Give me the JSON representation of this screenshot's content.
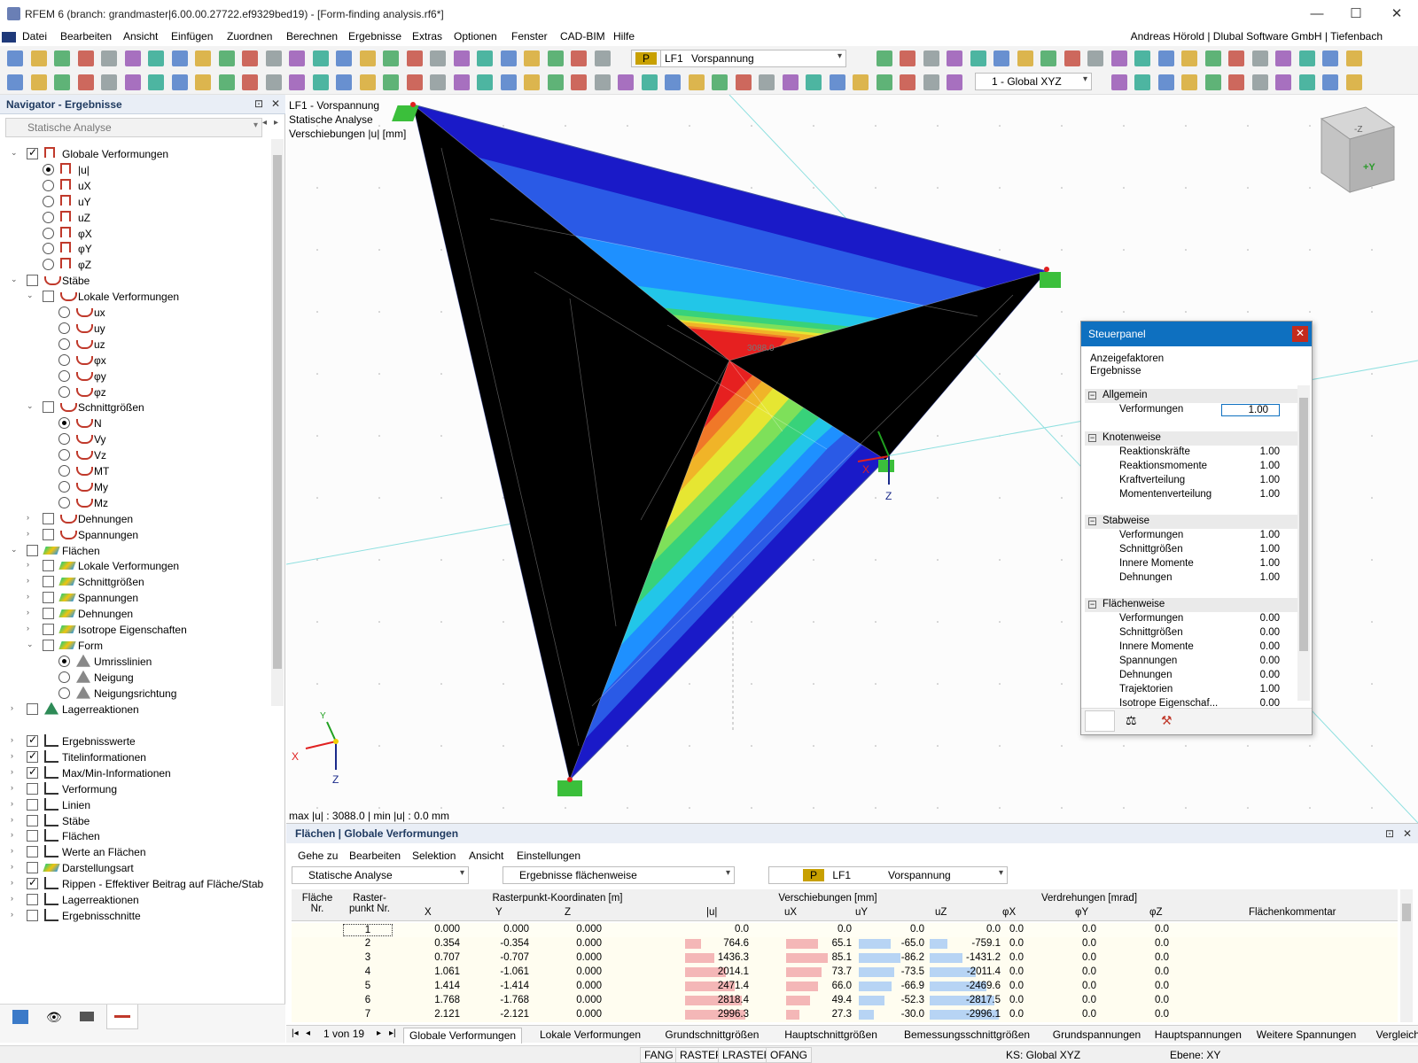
{
  "window": {
    "title": "RFEM 6 (branch: grandmaster|6.00.00.27722.ef9329bed19) - [Form-finding analysis.rf6*]"
  },
  "menu": {
    "items": [
      "Datei",
      "Bearbeiten",
      "Ansicht",
      "Einfügen",
      "Zuordnen",
      "Berechnen",
      "Ergebnisse",
      "Extras",
      "Optionen",
      "Fenster",
      "CAD-BIM",
      "Hilfe"
    ],
    "user": "Andreas Hörold | Dlubal Software GmbH | Tiefenbach"
  },
  "toolbar": {
    "lc_code": "P",
    "lc_name": "LF1",
    "lc_desc": "Vorspannung",
    "coord_system": "1 - Global XYZ"
  },
  "navigator": {
    "title": "Navigator - Ergebnisse",
    "analysis": "Statische Analyse",
    "items": [
      {
        "label": "Globale Verformungen",
        "level": 0,
        "ctrl": "cb",
        "checked": true,
        "exp": "v",
        "icon": "def"
      },
      {
        "label": "|u|",
        "level": 1,
        "ctrl": "rb",
        "checked": true,
        "icon": "def"
      },
      {
        "label": "uX",
        "level": 1,
        "ctrl": "rb",
        "checked": false,
        "icon": "def"
      },
      {
        "label": "uY",
        "level": 1,
        "ctrl": "rb",
        "checked": false,
        "icon": "def"
      },
      {
        "label": "uZ",
        "level": 1,
        "ctrl": "rb",
        "checked": false,
        "icon": "def"
      },
      {
        "label": "φX",
        "level": 1,
        "ctrl": "rb",
        "checked": false,
        "icon": "def"
      },
      {
        "label": "φY",
        "level": 1,
        "ctrl": "rb",
        "checked": false,
        "icon": "def"
      },
      {
        "label": "φZ",
        "level": 1,
        "ctrl": "rb",
        "checked": false,
        "icon": "def"
      },
      {
        "label": "Stäbe",
        "level": 0,
        "ctrl": "cb",
        "checked": false,
        "exp": "v",
        "icon": "memb"
      },
      {
        "label": "Lokale Verformungen",
        "level": 1,
        "ctrl": "cb",
        "checked": false,
        "exp": "v",
        "icon": "memb"
      },
      {
        "label": "ux",
        "level": 2,
        "ctrl": "rb",
        "checked": false,
        "icon": "memb"
      },
      {
        "label": "uy",
        "level": 2,
        "ctrl": "rb",
        "checked": false,
        "icon": "memb"
      },
      {
        "label": "uz",
        "level": 2,
        "ctrl": "rb",
        "checked": false,
        "icon": "memb"
      },
      {
        "label": "φx",
        "level": 2,
        "ctrl": "rb",
        "checked": false,
        "icon": "memb"
      },
      {
        "label": "φy",
        "level": 2,
        "ctrl": "rb",
        "checked": false,
        "icon": "memb"
      },
      {
        "label": "φz",
        "level": 2,
        "ctrl": "rb",
        "checked": false,
        "icon": "memb"
      },
      {
        "label": "Schnittgrößen",
        "level": 1,
        "ctrl": "cb",
        "checked": false,
        "exp": "v",
        "icon": "memb"
      },
      {
        "label": "N",
        "level": 2,
        "ctrl": "rb",
        "checked": true,
        "icon": "memb"
      },
      {
        "label": "Vy",
        "level": 2,
        "ctrl": "rb",
        "checked": false,
        "icon": "memb"
      },
      {
        "label": "Vz",
        "level": 2,
        "ctrl": "rb",
        "checked": false,
        "icon": "memb"
      },
      {
        "label": "MT",
        "level": 2,
        "ctrl": "rb",
        "checked": false,
        "icon": "memb"
      },
      {
        "label": "My",
        "level": 2,
        "ctrl": "rb",
        "checked": false,
        "icon": "memb"
      },
      {
        "label": "Mz",
        "level": 2,
        "ctrl": "rb",
        "checked": false,
        "icon": "memb"
      },
      {
        "label": "Dehnungen",
        "level": 1,
        "ctrl": "cb",
        "checked": false,
        "exp": ">",
        "icon": "memb"
      },
      {
        "label": "Spannungen",
        "level": 1,
        "ctrl": "cb",
        "checked": false,
        "exp": ">",
        "icon": "memb"
      },
      {
        "label": "Flächen",
        "level": 0,
        "ctrl": "cb",
        "checked": false,
        "exp": "v",
        "icon": "surf"
      },
      {
        "label": "Lokale Verformungen",
        "level": 1,
        "ctrl": "cb",
        "checked": false,
        "exp": ">",
        "icon": "surf"
      },
      {
        "label": "Schnittgrößen",
        "level": 1,
        "ctrl": "cb",
        "checked": false,
        "exp": ">",
        "icon": "surf"
      },
      {
        "label": "Spannungen",
        "level": 1,
        "ctrl": "cb",
        "checked": false,
        "exp": ">",
        "icon": "surf"
      },
      {
        "label": "Dehnungen",
        "level": 1,
        "ctrl": "cb",
        "checked": false,
        "exp": ">",
        "icon": "surf"
      },
      {
        "label": "Isotrope Eigenschaften",
        "level": 1,
        "ctrl": "cb",
        "checked": false,
        "exp": ">",
        "icon": "surf"
      },
      {
        "label": "Form",
        "level": 1,
        "ctrl": "cb",
        "checked": false,
        "exp": "v",
        "icon": "surf"
      },
      {
        "label": "Umrisslinien",
        "level": 2,
        "ctrl": "rb",
        "checked": true,
        "icon": "shape"
      },
      {
        "label": "Neigung",
        "level": 2,
        "ctrl": "rb",
        "checked": false,
        "icon": "shape"
      },
      {
        "label": "Neigungsrichtung",
        "level": 2,
        "ctrl": "rb",
        "checked": false,
        "icon": "shape"
      },
      {
        "label": "Lagerreaktionen",
        "level": 0,
        "ctrl": "cb",
        "checked": false,
        "exp": ">",
        "icon": "sup"
      }
    ],
    "display_items": [
      {
        "label": "Ergebnisswerte",
        "checked": true,
        "icon": "res"
      },
      {
        "label": "Titelinformationen",
        "checked": true,
        "icon": "res"
      },
      {
        "label": "Max/Min-Informationen",
        "checked": true,
        "icon": "res"
      },
      {
        "label": "Verformung",
        "checked": false,
        "icon": "res"
      },
      {
        "label": "Linien",
        "checked": false,
        "icon": "res"
      },
      {
        "label": "Stäbe",
        "checked": false,
        "icon": "res"
      },
      {
        "label": "Flächen",
        "checked": false,
        "icon": "res"
      },
      {
        "label": "Werte an Flächen",
        "checked": false,
        "icon": "res"
      },
      {
        "label": "Darstellungsart",
        "checked": false,
        "icon": "surf"
      },
      {
        "label": "Rippen - Effektiver Beitrag auf Fläche/Stab",
        "checked": true,
        "icon": "res"
      },
      {
        "label": "Lagerreaktionen",
        "checked": false,
        "icon": "res"
      },
      {
        "label": "Ergebnisschnitte",
        "checked": false,
        "icon": "res"
      }
    ]
  },
  "viewport": {
    "info1": "LF1 - Vorspannung",
    "info2": "Statische Analyse",
    "info3": "Verschiebungen |u| [mm]",
    "maxmin": "max |u| : 3088.0 | min |u| : 0.0 mm",
    "max_label": "3088.0",
    "axis_x": "X",
    "axis_y": "Y",
    "axis_z": "Z",
    "cube_top": "-Z",
    "cube_front": "+Y"
  },
  "steuerpanel": {
    "title": "Steuerpanel",
    "sub1": "Anzeigefaktoren",
    "sub2": "Ergebnisse",
    "sections": [
      {
        "name": "Allgemein",
        "rows": [
          {
            "label": "Verformungen",
            "value": "1.00"
          }
        ]
      },
      {
        "name": "Knotenweise",
        "rows": [
          {
            "label": "Reaktionskräfte",
            "value": "1.00"
          },
          {
            "label": "Reaktionsmomente",
            "value": "1.00"
          },
          {
            "label": "Kraftverteilung",
            "value": "1.00"
          },
          {
            "label": "Momentenverteilung",
            "value": "1.00"
          }
        ]
      },
      {
        "name": "Stabweise",
        "rows": [
          {
            "label": "Verformungen",
            "value": "1.00"
          },
          {
            "label": "Schnittgrößen",
            "value": "1.00"
          },
          {
            "label": "Innere Momente",
            "value": "1.00"
          },
          {
            "label": "Dehnungen",
            "value": "1.00"
          }
        ]
      },
      {
        "name": "Flächenweise",
        "rows": [
          {
            "label": "Verformungen",
            "value": "0.00"
          },
          {
            "label": "Schnittgrößen",
            "value": "0.00"
          },
          {
            "label": "Innere Momente",
            "value": "0.00"
          },
          {
            "label": "Spannungen",
            "value": "0.00"
          },
          {
            "label": "Dehnungen",
            "value": "0.00"
          },
          {
            "label": "Trajektorien",
            "value": "1.00"
          },
          {
            "label": "Isotrope Eigenschaf...",
            "value": "0.00"
          }
        ]
      }
    ]
  },
  "results": {
    "title": "Flächen | Globale Verformungen",
    "menu": [
      "Gehe zu",
      "Bearbeiten",
      "Selektion",
      "Ansicht",
      "Einstellungen"
    ],
    "analysis": "Statische Analyse",
    "result_type": "Ergebnisse flächenweise",
    "lc_code": "P",
    "lc_name": "LF1",
    "lc_desc": "Vorspannung",
    "headers": {
      "flaeche": "Fläche Nr.",
      "raster": "Raster- punkt Nr.",
      "coords": "Rasterpunkt-Koordinaten [m]",
      "x": "X",
      "y": "Y",
      "z": "Z",
      "verschiebungen": "Verschiebungen [mm]",
      "u": "|u|",
      "ux": "uX",
      "uy": "uY",
      "uz": "uZ",
      "verdrehungen": "Verdrehungen [mrad]",
      "px": "φX",
      "py": "φY",
      "pz": "φZ",
      "kommentar": "Flächenkommentar"
    },
    "surface_no": "1",
    "rows": [
      {
        "n": "1",
        "x": "0.000",
        "y": "0.000",
        "z": "0.000",
        "u": "0.0",
        "ux": "0.0",
        "uy": "0.0",
        "uz": "0.0",
        "px": "0.0",
        "py": "0.0",
        "pz": "0.0",
        "fu": 0,
        "fx": 0,
        "fy": 0,
        "fz": 0
      },
      {
        "n": "2",
        "x": "0.354",
        "y": "-0.354",
        "z": "0.000",
        "u": "764.6",
        "ux": "65.1",
        "uy": "-65.0",
        "uz": "-759.1",
        "px": "0.0",
        "py": "0.0",
        "pz": "0.0",
        "fu": 0.25,
        "fx": 0.5,
        "fy": 0.5,
        "fz": 0.25
      },
      {
        "n": "3",
        "x": "0.707",
        "y": "-0.707",
        "z": "0.000",
        "u": "1436.3",
        "ux": "85.1",
        "uy": "-86.2",
        "uz": "-1431.2",
        "px": "0.0",
        "py": "0.0",
        "pz": "0.0",
        "fu": 0.47,
        "fx": 0.65,
        "fy": 0.65,
        "fz": 0.48
      },
      {
        "n": "4",
        "x": "1.061",
        "y": "-1.061",
        "z": "0.000",
        "u": "2014.1",
        "ux": "73.7",
        "uy": "-73.5",
        "uz": "-2011.4",
        "px": "0.0",
        "py": "0.0",
        "pz": "0.0",
        "fu": 0.65,
        "fx": 0.56,
        "fy": 0.56,
        "fz": 0.67
      },
      {
        "n": "5",
        "x": "1.414",
        "y": "-1.414",
        "z": "0.000",
        "u": "2471.4",
        "ux": "66.0",
        "uy": "-66.9",
        "uz": "-2469.6",
        "px": "0.0",
        "py": "0.0",
        "pz": "0.0",
        "fu": 0.8,
        "fx": 0.5,
        "fy": 0.51,
        "fz": 0.82
      },
      {
        "n": "6",
        "x": "1.768",
        "y": "-1.768",
        "z": "0.000",
        "u": "2818.4",
        "ux": "49.4",
        "uy": "-52.3",
        "uz": "-2817.5",
        "px": "0.0",
        "py": "0.0",
        "pz": "0.0",
        "fu": 0.91,
        "fx": 0.38,
        "fy": 0.4,
        "fz": 0.94
      },
      {
        "n": "7",
        "x": "2.121",
        "y": "-2.121",
        "z": "0.000",
        "u": "2996.3",
        "ux": "27.3",
        "uy": "-30.0",
        "uz": "-2996.1",
        "px": "0.0",
        "py": "0.0",
        "pz": "0.0",
        "fu": 0.97,
        "fx": 0.21,
        "fy": 0.23,
        "fz": 1.0
      }
    ],
    "pager": "1 von 19",
    "tabs": [
      "Globale Verformungen",
      "Lokale Verformungen",
      "Grundschnittgrößen",
      "Hauptschnittgrößen",
      "Bemessungsschnittgrößen",
      "Grundspannungen",
      "Hauptspannungen",
      "Weitere Spannungen",
      "Vergleichsspannu"
    ]
  },
  "statusbar": {
    "buttons": [
      "FANG",
      "RASTER",
      "LRASTER",
      "OFANG"
    ],
    "ks": "KS: Global XYZ",
    "ebene": "Ebene: XY"
  },
  "colors": {
    "accent": "#0e70c0",
    "contour": [
      "#1a1ac8",
      "#2a5ae6",
      "#1e90ff",
      "#22c6e8",
      "#1ee0b8",
      "#38d27a",
      "#7ee05a",
      "#e6e632",
      "#f0b428",
      "#f07828",
      "#e62020"
    ]
  }
}
